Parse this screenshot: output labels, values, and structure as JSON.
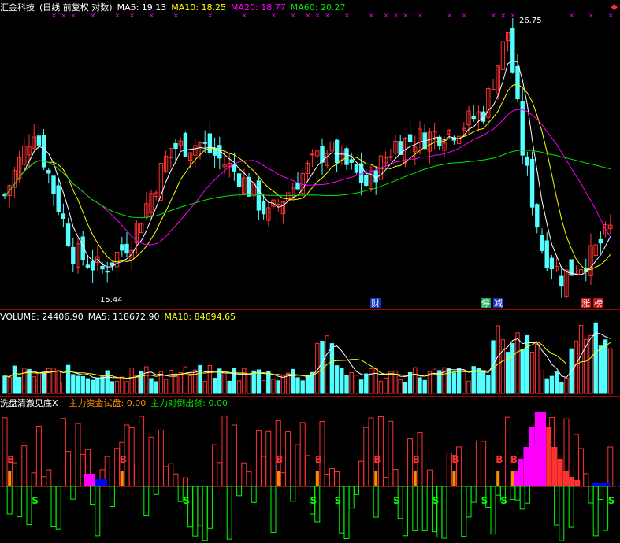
{
  "price_panel": {
    "stock_name": "汇金科技",
    "mode": "(日线 前复权 对数)",
    "ma5": "MA5: 19.13",
    "ma10": "MA10: 18.25",
    "ma20": "MA20: 18.77",
    "ma60": "MA60: 20.27",
    "high_label": "26.75",
    "low_label": "15.44",
    "event_tags": [
      "财",
      "停",
      "减",
      "涨",
      "榜"
    ]
  },
  "volume_panel": {
    "volume": "VOLUME: 24406.90",
    "ma5": "MA5: 118672.90",
    "ma10": "MA10: 84694.65"
  },
  "indicator_panel": {
    "name": "洗盘清澈见底X",
    "test": "主力资金试盘: 0.00",
    "dump": "主力对倒出货: 0.00",
    "buy_mark": "B",
    "sell_mark": "S"
  },
  "colors": {
    "up": "#ff3232",
    "down": "#54ffff",
    "ma5": "#ffffff",
    "ma10": "#ffff00",
    "ma20": "#ff00ff",
    "ma60": "#00e600",
    "frame": "#a00000",
    "magenta_bar": "#ff00ff",
    "orange": "#ff8c00",
    "green_bar": "#00ff00",
    "blue": "#0000ff"
  },
  "chart_data": {
    "type": "candlestick",
    "price_range": [
      15.0,
      27.5
    ],
    "high": 26.75,
    "low": 15.44,
    "ma_latest": {
      "MA5": 19.13,
      "MA10": 18.25,
      "MA20": 18.77,
      "MA60": 20.27
    },
    "volume_latest": {
      "VOLUME": 24406.9,
      "MA5": 118672.9,
      "MA10": 84694.65
    },
    "indicator_latest": {
      "主力资金试盘": 0.0,
      "主力对倒出货": 0.0
    }
  }
}
